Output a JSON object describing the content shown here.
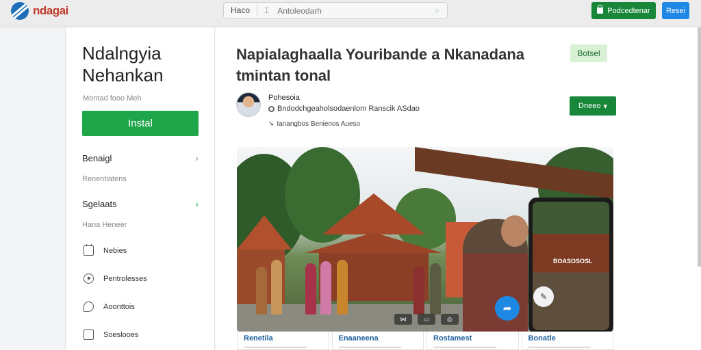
{
  "brand": {
    "name": "ndagai"
  },
  "search": {
    "scope": "Haco",
    "placeholder": "Antoleodarh"
  },
  "topbar": {
    "green_button": "Podcedtenar",
    "blue_button": "Resei"
  },
  "sidebar": {
    "app_name_line1": "Ndalngyia",
    "app_name_line2": "Nehankan",
    "subtitle": "Montad fooo Meh",
    "install_label": "Instal",
    "sections": [
      {
        "label": "Benaigl",
        "sub": "Renentiatens"
      },
      {
        "label": "Sgelaats",
        "sub": "Hana Heneer"
      }
    ],
    "items": [
      {
        "label": "Nebies",
        "icon": "calendar-icon"
      },
      {
        "label": "Pentrolesses",
        "icon": "play-icon"
      },
      {
        "label": "Aoonttois",
        "icon": "chat-icon"
      },
      {
        "label": "Soeslooes",
        "icon": "square-icon"
      }
    ]
  },
  "article": {
    "headline": "Napialaghaalla Youribande a Nkanadana tmintan tonal",
    "badge": "Botsel",
    "author": {
      "name": "Pohesoia",
      "meta": "Bndodchgeaholsodaenlom Ranscik ASdao",
      "meta2": "Ianangbos Benienos Aueso"
    },
    "follow_label": "Dneeo",
    "phone_label": "BOASOSOSL",
    "cards": [
      {
        "title": "Renetila"
      },
      {
        "title": "Enaaneena"
      },
      {
        "title": "Rostamest"
      },
      {
        "title": "Bonatle"
      }
    ]
  },
  "colors": {
    "primary_green": "#1fa64b",
    "dark_green": "#18873a",
    "blue": "#1e88e5",
    "brand_red": "#c0392b"
  }
}
